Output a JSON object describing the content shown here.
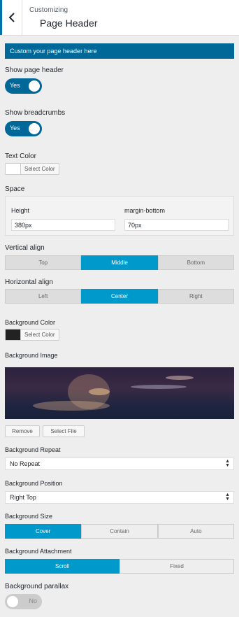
{
  "header": {
    "breadcrumb": "Customizing",
    "title": "Page Header"
  },
  "banner": "Custom your page header here",
  "show_page_header": {
    "label": "Show page header",
    "value": "Yes"
  },
  "show_breadcrumbs": {
    "label": "Show breadcrumbs",
    "value": "Yes"
  },
  "text_color": {
    "label": "Text Color",
    "button": "Select Color",
    "swatch": "#ffffff"
  },
  "space": {
    "label": "Space",
    "height_label": "Height",
    "height_value": "380px",
    "margin_label": "margin-bottom",
    "margin_value": "70px"
  },
  "vertical_align": {
    "label": "Vertical align",
    "options": [
      "Top",
      "Middle",
      "Bottom"
    ],
    "selected": "Middle"
  },
  "horizontal_align": {
    "label": "Horizontal align",
    "options": [
      "Left",
      "Center",
      "Right"
    ],
    "selected": "Center"
  },
  "background_color": {
    "label": "Background Color",
    "button": "Select Color",
    "swatch": "#222222"
  },
  "background_image": {
    "label": "Background Image",
    "remove": "Remove",
    "select_file": "Select File"
  },
  "background_repeat": {
    "label": "Background Repeat",
    "value": "No Repeat"
  },
  "background_position": {
    "label": "Background Position",
    "value": "Right Top"
  },
  "background_size": {
    "label": "Background Size",
    "options": [
      "Cover",
      "Contain",
      "Auto"
    ],
    "selected": "Cover"
  },
  "background_attachment": {
    "label": "Background Attachment",
    "options": [
      "Scroll",
      "Fixed"
    ],
    "selected": "Scroll"
  },
  "background_parallax": {
    "label": "Background parallax",
    "value": "No"
  },
  "colors": {
    "accent": "#006799",
    "active_segment": "#0099cc"
  },
  "icons": {
    "back": "chevron-left-icon",
    "select_arrow": "up-down-arrow-icon"
  }
}
